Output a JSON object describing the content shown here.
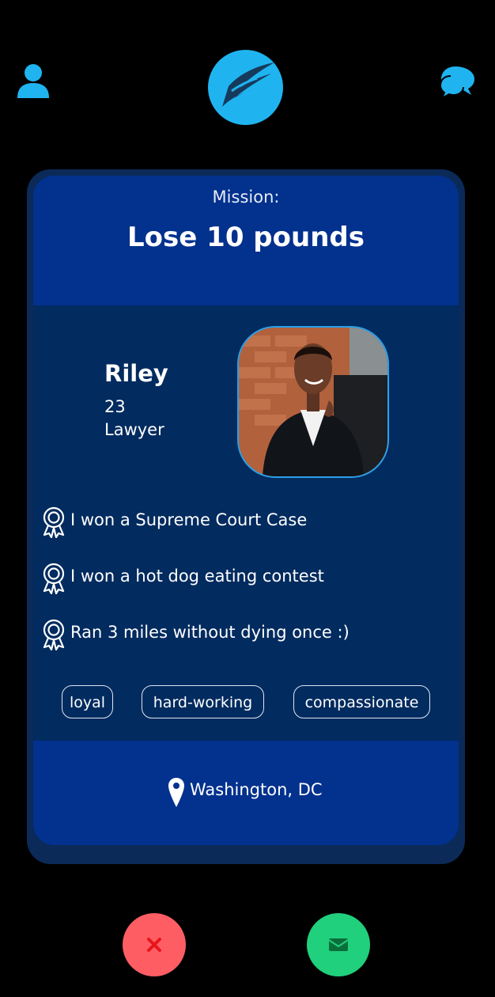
{
  "header": {
    "profile_icon": "person-icon",
    "logo_icon": "wing-logo-icon",
    "chat_icon": "chat-bubbles-icon"
  },
  "card": {
    "mission_label": "Mission:",
    "mission_title": "Lose 10 pounds",
    "name": "Riley",
    "age": "23",
    "occupation": "Lawyer",
    "achievements": [
      {
        "icon": "award-ribbon-icon",
        "text": "I won a Supreme Court Case"
      },
      {
        "icon": "award-ribbon-icon",
        "text": "I won a hot dog eating contest"
      },
      {
        "icon": "award-ribbon-icon",
        "text": "Ran 3 miles without dying once :)"
      }
    ],
    "tags": [
      "loyal",
      "hard-working",
      "compassionate"
    ],
    "location": "Washington, DC"
  },
  "actions": {
    "reject_icon": "close-icon",
    "message_icon": "envelope-icon"
  },
  "colors": {
    "accent": "#1fb4f0",
    "mission_bg": "#02318e",
    "card_bg": "#022b5f",
    "reject": "#fe5e63",
    "accept": "#20d07c"
  }
}
